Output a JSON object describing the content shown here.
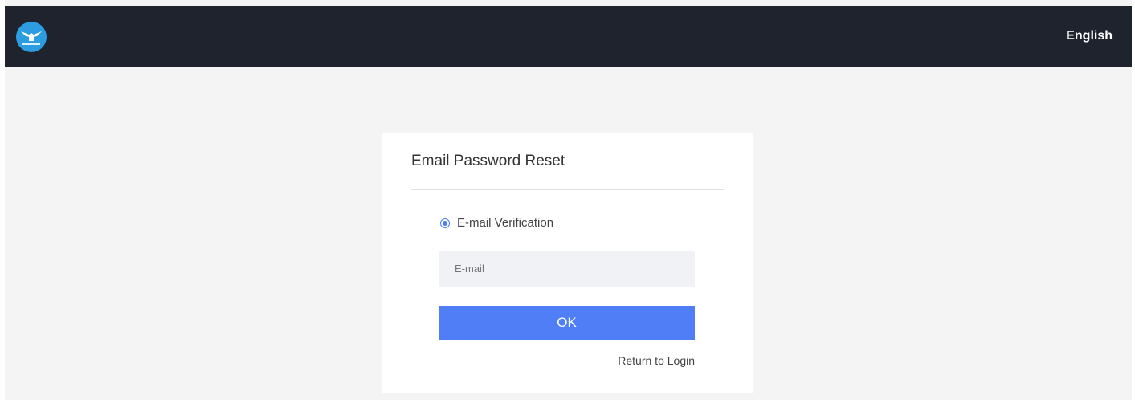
{
  "header": {
    "logo_icon": "command-center-logo-icon",
    "language_label": "English"
  },
  "card": {
    "title": "Email Password Reset",
    "verification_option": {
      "label": "E-mail Verification",
      "checked": true
    },
    "email": {
      "placeholder": "E-mail",
      "value": ""
    },
    "ok_label": "OK",
    "return_label": "Return to Login"
  },
  "colors": {
    "topbar": "#1f232e",
    "accent": "#4f7ef7",
    "background": "#f4f4f4",
    "logo": "#2b9de0"
  }
}
